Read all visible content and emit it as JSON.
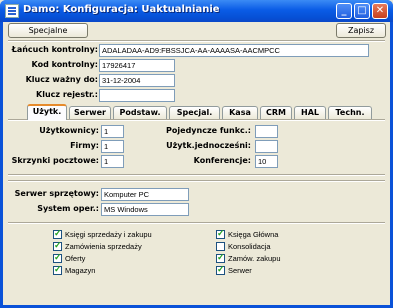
{
  "window": {
    "title": "Damo: Konfiguracja: Uaktualnianie"
  },
  "title_buttons": {
    "minimize": "_",
    "maximize": "□",
    "close": "✕"
  },
  "toolbar": {
    "special_label": "Specjalne",
    "save_label": "Zapisz"
  },
  "license": {
    "chain_label": "Łańcuch kontrolny:",
    "chain_value": "ADALADAA-AD9:FBSSJCA-AA-AAAASA-AACMPCC",
    "code_label": "Kod kontrolny:",
    "code_value": "17926417",
    "valid_label": "Klucz ważny do:",
    "valid_value": "31-12-2004",
    "register_label": "Klucz rejestr.:",
    "register_value": ""
  },
  "tabs": [
    {
      "label": "Użytk.",
      "active": true
    },
    {
      "label": "Serwer"
    },
    {
      "label": "Podstaw."
    },
    {
      "label": "Specjal."
    },
    {
      "label": "Kasa"
    },
    {
      "label": "CRM"
    },
    {
      "label": "HAL"
    },
    {
      "label": "Techn."
    }
  ],
  "users": {
    "users_label": "Użytkownicy:",
    "users_value": "1",
    "firms_label": "Firmy:",
    "firms_value": "1",
    "mailbox_label": "Skrzynki pocztowe:",
    "mailbox_value": "1",
    "single_label": "Pojedyncze funkc.:",
    "single_value": "",
    "concurrent_label": "Użytk.jednocześni:",
    "concurrent_value": "",
    "conf_label": "Konferencje:",
    "conf_value": "10"
  },
  "server": {
    "server_label": "Serwer sprzętowy:",
    "server_value": "Komputer PC",
    "os_label": "System oper.:",
    "os_value": "MS Windows"
  },
  "modules": [
    {
      "label": "Księgi sprzedaży i zakupu",
      "checked": true
    },
    {
      "label": "Zamówienia sprzedaży",
      "checked": true
    },
    {
      "label": "Oferty",
      "checked": true
    },
    {
      "label": "Magazyn",
      "checked": true
    },
    {
      "label": "Księga Główna",
      "checked": true
    },
    {
      "label": "Konsolidacja",
      "checked": false
    },
    {
      "label": "Zamów. zakupu",
      "checked": true
    },
    {
      "label": "Serwer",
      "checked": true
    }
  ]
}
